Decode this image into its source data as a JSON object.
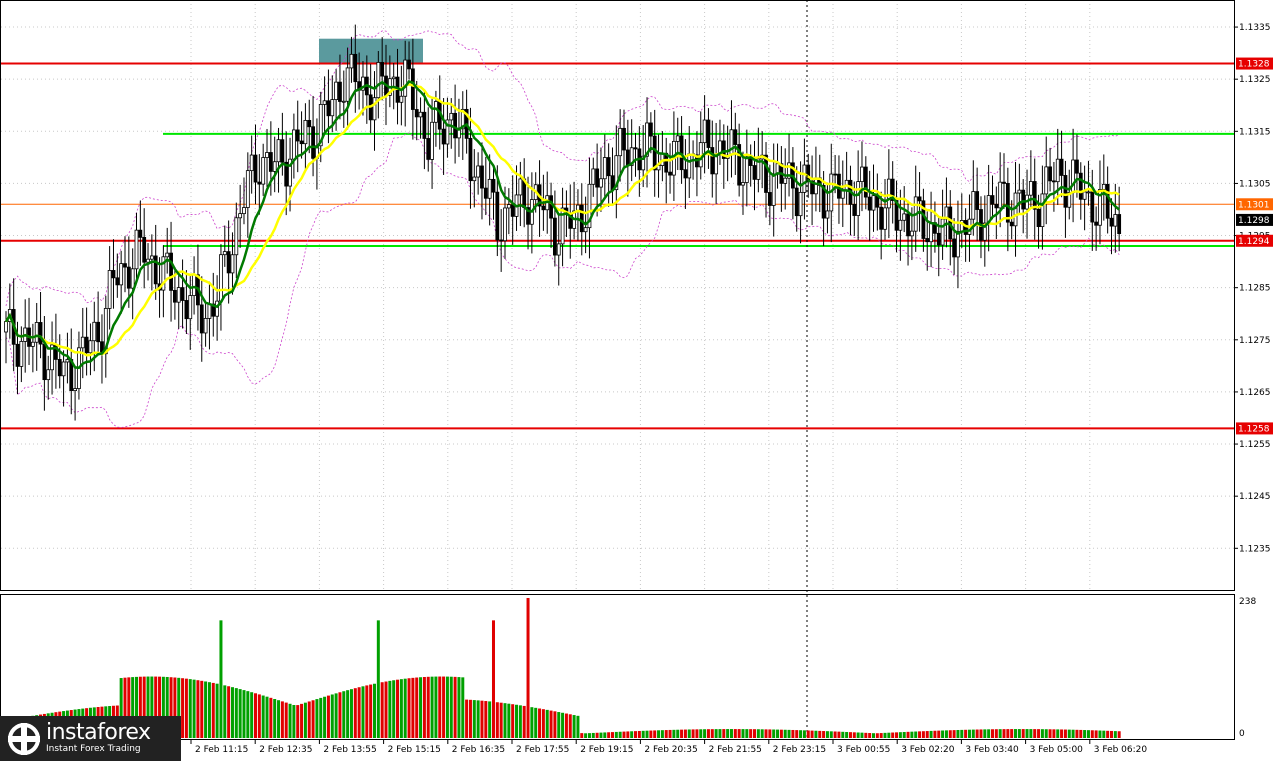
{
  "brand": {
    "name": "instaforex",
    "tagline": "Instant Forex Trading"
  },
  "colors": {
    "bull_candle": "#009900",
    "bear_candle": "#000000",
    "ma_fast": "#007a00",
    "ma_slow": "#ffff00",
    "envelope": "#cc44cc",
    "resistance": "#e60000",
    "support_green": "#00e600",
    "bid_line": "#ff6600",
    "zone": "#5b9a9e",
    "vol_up": "#00a000",
    "vol_down": "#e00000"
  },
  "chart_data": {
    "type": "candlestick",
    "symbol_timeframe_shown": false,
    "price_axis": {
      "range": [
        1.1227,
        1.134
      ],
      "ticks": [
        "1.1335",
        "1.1325",
        "1.1315",
        "1.1305",
        "1.1295",
        "1.1285",
        "1.1275",
        "1.1265",
        "1.1255",
        "1.1245",
        "1.1235"
      ]
    },
    "time_axis": {
      "labels": [
        "2 Feb 11:15",
        "2 Feb 12:35",
        "2 Feb 13:55",
        "2 Feb 15:15",
        "2 Feb 16:35",
        "2 Feb 17:55",
        "2 Feb 19:15",
        "2 Feb 20:35",
        "2 Feb 21:55",
        "2 Feb 23:15",
        "3 Feb 00:55",
        "3 Feb 02:20",
        "3 Feb 03:40",
        "3 Feb 05:00",
        "3 Feb 06:20"
      ]
    },
    "horizontal_levels": [
      {
        "price": 1.1328,
        "label": "1.1328",
        "kind": "resistance"
      },
      {
        "price": 1.1301,
        "label": "1.1301",
        "kind": "bid"
      },
      {
        "price": 1.1294,
        "label": "1.1294",
        "kind": "support"
      },
      {
        "price": 1.1258,
        "label": "1.1258",
        "kind": "resistance"
      },
      {
        "price": 1.13145,
        "kind": "green_line"
      },
      {
        "price": 1.1293,
        "kind": "green_line"
      }
    ],
    "current_price": "1.1298",
    "zone": {
      "price_low": 1.1328,
      "price_high": 1.1332
    },
    "close_path": [
      [
        0,
        1.1276
      ],
      [
        5,
        1.1275
      ],
      [
        10,
        1.1273
      ],
      [
        15,
        1.1268
      ],
      [
        20,
        1.1272
      ],
      [
        25,
        1.1278
      ],
      [
        28,
        1.1286
      ],
      [
        32,
        1.129
      ],
      [
        36,
        1.1292
      ],
      [
        40,
        1.1288
      ],
      [
        44,
        1.1285
      ],
      [
        48,
        1.1282
      ],
      [
        52,
        1.128
      ],
      [
        55,
        1.1283
      ],
      [
        58,
        1.1292
      ],
      [
        62,
        1.1302
      ],
      [
        66,
        1.131
      ],
      [
        70,
        1.1308
      ],
      [
        75,
        1.1312
      ],
      [
        80,
        1.1315
      ],
      [
        85,
        1.132
      ],
      [
        88,
        1.1326
      ],
      [
        92,
        1.1324
      ],
      [
        96,
        1.1322
      ],
      [
        100,
        1.1325
      ],
      [
        104,
        1.1324
      ],
      [
        107,
        1.132
      ],
      [
        110,
        1.1313
      ],
      [
        113,
        1.1316
      ],
      [
        116,
        1.1318
      ],
      [
        120,
        1.1312
      ],
      [
        124,
        1.1305
      ],
      [
        128,
        1.1298
      ],
      [
        132,
        1.13
      ],
      [
        136,
        1.1303
      ],
      [
        140,
        1.13
      ],
      [
        144,
        1.1296
      ],
      [
        148,
        1.1298
      ],
      [
        152,
        1.1302
      ],
      [
        156,
        1.1308
      ],
      [
        160,
        1.131
      ],
      [
        165,
        1.1312
      ],
      [
        170,
        1.131
      ],
      [
        175,
        1.1309
      ],
      [
        180,
        1.1311
      ],
      [
        185,
        1.1312
      ],
      [
        190,
        1.131
      ],
      [
        195,
        1.1307
      ],
      [
        200,
        1.1306
      ],
      [
        205,
        1.1305
      ],
      [
        210,
        1.1304
      ],
      [
        215,
        1.1303
      ],
      [
        220,
        1.1304
      ],
      [
        225,
        1.1302
      ],
      [
        230,
        1.13
      ],
      [
        235,
        1.1298
      ],
      [
        240,
        1.1297
      ],
      [
        245,
        1.1295
      ],
      [
        250,
        1.1297
      ],
      [
        255,
        1.13
      ],
      [
        260,
        1.1302
      ],
      [
        265,
        1.1301
      ],
      [
        270,
        1.1303
      ],
      [
        274,
        1.1307
      ],
      [
        278,
        1.1305
      ],
      [
        282,
        1.1302
      ],
      [
        286,
        1.13
      ],
      [
        290,
        1.1297
      ]
    ],
    "volume_axis": {
      "max_label": "238",
      "min_label": "0"
    }
  }
}
